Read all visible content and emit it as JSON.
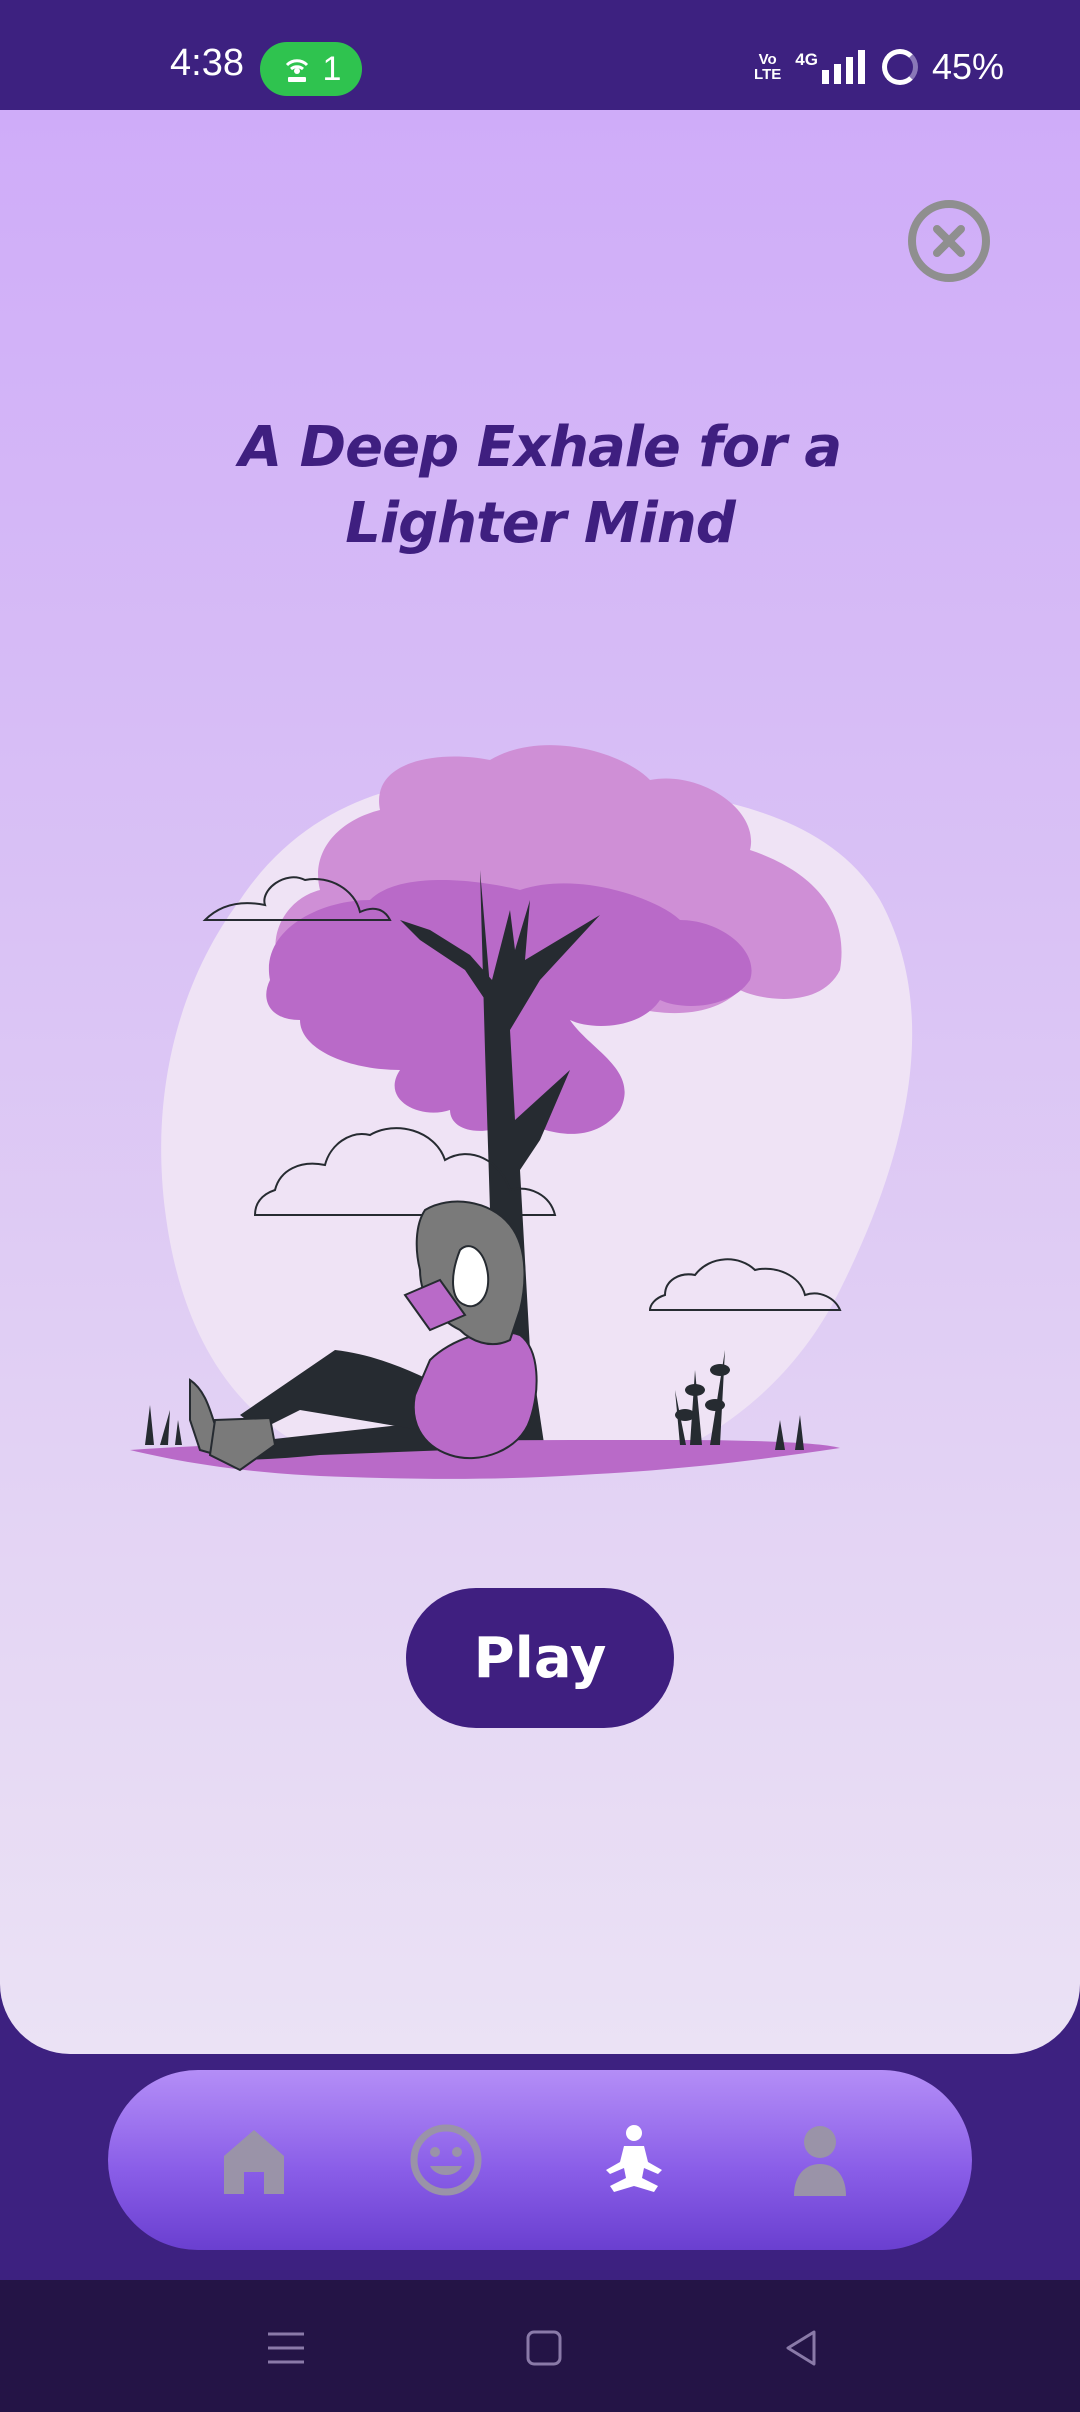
{
  "status_bar": {
    "time": "4:38",
    "hotspot_count": "1",
    "volte_line1": "Vo",
    "volte_line2": "LTE",
    "network": "4G",
    "battery": "45%"
  },
  "screen": {
    "title": "A Deep Exhale for a Lighter Mind",
    "play_label": "Play"
  },
  "bottom_nav": {
    "items": [
      {
        "icon": "home-icon"
      },
      {
        "icon": "smiley-icon"
      },
      {
        "icon": "meditation-icon"
      },
      {
        "icon": "profile-icon"
      }
    ]
  },
  "system_nav": {
    "items": [
      {
        "icon": "menu-icon"
      },
      {
        "icon": "home-square-icon"
      },
      {
        "icon": "back-triangle-icon"
      }
    ]
  },
  "colors": {
    "accent": "#3f1f80",
    "card_top": "#cfacf9",
    "card_bottom": "#ebe2f5",
    "nav_pill": "#8a5ee8"
  }
}
